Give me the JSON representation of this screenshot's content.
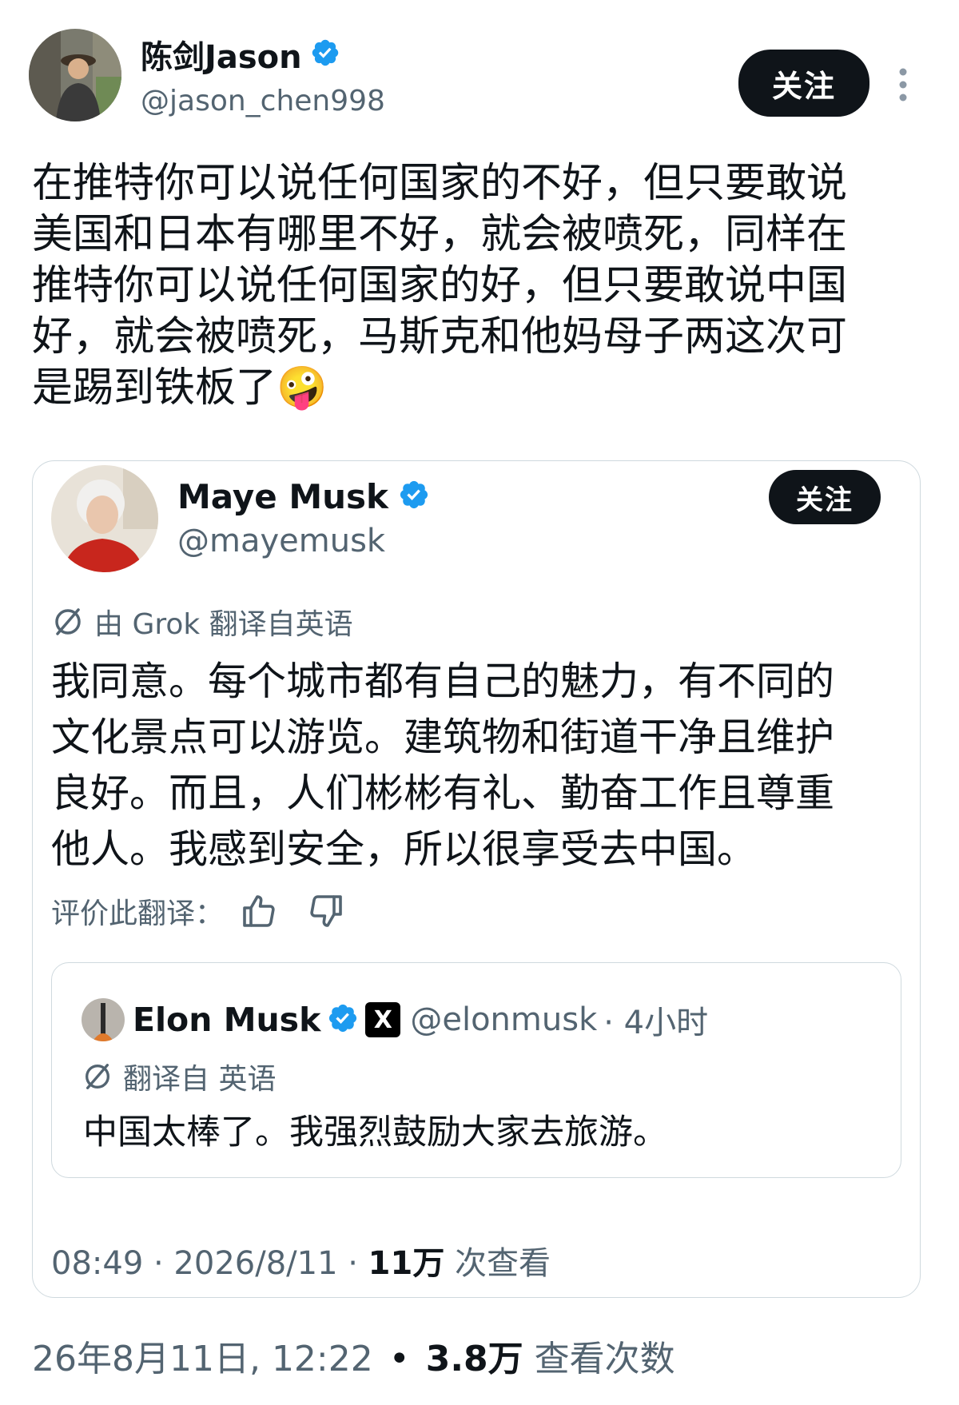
{
  "post": {
    "author_name": "陈剑Jason",
    "author_handle": "@jason_chen998",
    "follow_label": "关注",
    "text_lines": [
      "在推特你可以说任何国家的不好，但只要敢说",
      "美国和日本有哪里不好，就会被喷死，同样在",
      "推特你可以说任何国家的好，但只要敢说中国",
      "好，就会被喷死，马斯克和他妈母子两这次可",
      "是踢到铁板了🤪"
    ],
    "footer_time": "26年8月11日, 12:22",
    "footer_sep": "•",
    "footer_views": "3.8万",
    "footer_views_label": "查看次数"
  },
  "quote": {
    "author_name": "Maye Musk",
    "author_handle": "@mayemusk",
    "follow_label": "关注",
    "translate_label": "由 Grok 翻译自英语",
    "text_lines": [
      "我同意。每个城市都有自己的魅力，有不同的",
      "文化景点可以游览。建筑物和街道干净且维护",
      "良好。而且，人们彬彬有礼、勤奋工作且尊重",
      "他人。我感到安全，所以很享受去中国。"
    ],
    "rate_label": "评价此翻译：",
    "footer_time": "08:49 · 2026/8/11 · ",
    "footer_views": "11万",
    "footer_views_label": " 次查看"
  },
  "nested": {
    "author_name": "Elon Musk",
    "badge": "X",
    "author_handle": "@elonmusk",
    "meta": "· 4小时",
    "translate_label": "翻译自 英语",
    "text": "中国太棒了。我强烈鼓励大家去旅游。"
  },
  "colors": {
    "verified_blue": "#1d9bf0",
    "text_primary": "#0f1419",
    "text_secondary": "#536471",
    "border": "#cfd9de"
  }
}
